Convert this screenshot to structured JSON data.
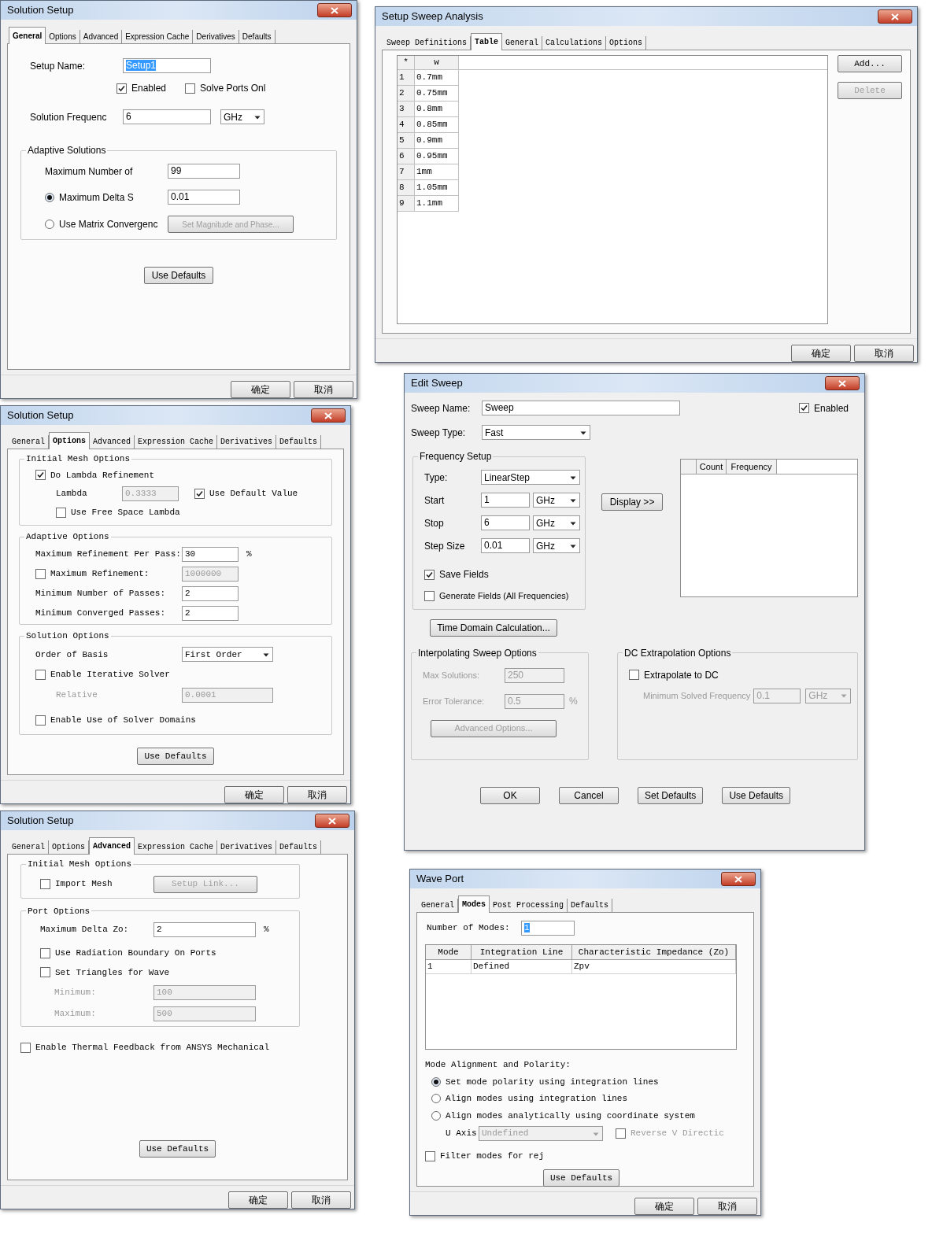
{
  "solution_setup_general": {
    "title": "Solution Setup",
    "tabs": [
      {
        "label": "General",
        "selected": true
      },
      {
        "label": "Options",
        "selected": false
      },
      {
        "label": "Advanced",
        "selected": false
      },
      {
        "label": "Expression Cache",
        "selected": false
      },
      {
        "label": "Derivatives",
        "selected": false
      },
      {
        "label": "Defaults",
        "selected": false
      }
    ],
    "setup_name": {
      "label": "Setup Name:",
      "value": "Setup1",
      "text_selected": true
    },
    "enabled": {
      "label": "Enabled",
      "checked": true
    },
    "solve_ports_only": {
      "label": "Solve Ports Onl",
      "checked": false
    },
    "solution_frequency": {
      "label": "Solution Frequenc",
      "value": "6",
      "unit": "GHz"
    },
    "adaptive_solutions": {
      "title": "Adaptive Solutions",
      "max_passes": {
        "label": "Maximum Number of",
        "value": "99"
      },
      "criteria": [
        {
          "label": "Maximum Delta S",
          "selected": true,
          "value": "0.01"
        },
        {
          "label": "Use Matrix Convergenc",
          "selected": false,
          "button": {
            "label": "Set Magnitude and Phase...",
            "disabled": true
          }
        }
      ]
    },
    "use_defaults": "Use Defaults",
    "buttons": [
      "确定",
      "取消"
    ]
  },
  "setup_sweep_analysis": {
    "title": "Setup Sweep Analysis",
    "tabs": [
      {
        "label": "Sweep Definitions",
        "selected": false
      },
      {
        "label": "Table",
        "selected": true
      },
      {
        "label": "General",
        "selected": false
      },
      {
        "label": "Calculations",
        "selected": false
      },
      {
        "label": "Options",
        "selected": false
      }
    ],
    "table": {
      "columns": [
        "*",
        "w"
      ],
      "rows": [
        [
          "1",
          "0.7mm"
        ],
        [
          "2",
          "0.75mm"
        ],
        [
          "3",
          "0.8mm"
        ],
        [
          "4",
          "0.85mm"
        ],
        [
          "5",
          "0.9mm"
        ],
        [
          "6",
          "0.95mm"
        ],
        [
          "7",
          "1mm"
        ],
        [
          "8",
          "1.05mm"
        ],
        [
          "9",
          "1.1mm"
        ]
      ]
    },
    "side_buttons": [
      {
        "label": "Add...",
        "disabled": false
      },
      {
        "label": "Delete",
        "disabled": true
      }
    ],
    "buttons": [
      "确定",
      "取消"
    ]
  },
  "solution_setup_options": {
    "title": "Solution Setup",
    "tabs": [
      {
        "label": "General",
        "selected": false
      },
      {
        "label": "Options",
        "selected": true
      },
      {
        "label": "Advanced",
        "selected": false
      },
      {
        "label": "Expression Cache",
        "selected": false
      },
      {
        "label": "Derivatives",
        "selected": false
      },
      {
        "label": "Defaults",
        "selected": false
      }
    ],
    "initial_mesh": {
      "title": "Initial Mesh Options",
      "lambda_refinement": {
        "label": "Do Lambda Refinement",
        "checked": true
      },
      "lambda": {
        "label": "Lambda",
        "value": "0.3333",
        "disabled": true
      },
      "use_default": {
        "label": "Use Default Value",
        "checked": true
      },
      "free_space": {
        "label": "Use Free Space Lambda",
        "checked": false
      }
    },
    "adaptive": {
      "title": "Adaptive Options",
      "max_refinement_per_pass": {
        "label": "Maximum Refinement Per Pass:",
        "value": "30",
        "unit": "%"
      },
      "max_refinement": {
        "label": "Maximum Refinement:",
        "checked": false,
        "value": "1000000",
        "disabled": true
      },
      "min_passes": {
        "label": "Minimum Number of Passes:",
        "value": "2"
      },
      "min_converged": {
        "label": "Minimum Converged Passes:",
        "value": "2"
      }
    },
    "solution_options": {
      "title": "Solution Options",
      "order_of_basis": {
        "label": "Order of Basis",
        "value": "First Order"
      },
      "iterative": {
        "label": "Enable Iterative Solver",
        "checked": false
      },
      "relative": {
        "label": "Relative",
        "value": "0.0001",
        "disabled": true
      },
      "solver_domains": {
        "label": "Enable Use of Solver Domains",
        "checked": false
      }
    },
    "use_defaults": "Use Defaults",
    "buttons": [
      "确定",
      "取消"
    ]
  },
  "solution_setup_advanced": {
    "title": "Solution Setup",
    "tabs": [
      {
        "label": "General",
        "selected": false
      },
      {
        "label": "Options",
        "selected": false
      },
      {
        "label": "Advanced",
        "selected": true
      },
      {
        "label": "Expression Cache",
        "selected": false
      },
      {
        "label": "Derivatives",
        "selected": false
      },
      {
        "label": "Defaults",
        "selected": false
      }
    ],
    "initial_mesh": {
      "title": "Initial Mesh Options",
      "import_mesh": {
        "label": "Import Mesh",
        "checked": false
      },
      "setup_link": {
        "label": "Setup Link...",
        "disabled": true
      }
    },
    "port_options": {
      "title": "Port Options",
      "max_delta_zo": {
        "label": "Maximum Delta Zo:",
        "value": "2",
        "unit": "%"
      },
      "radiation_boundary": {
        "label": "Use Radiation Boundary On Ports",
        "checked": false
      },
      "set_triangles": {
        "label": "Set Triangles for Wave",
        "checked": false
      },
      "minimum": {
        "label": "Minimum:",
        "value": "100",
        "disabled": true
      },
      "maximum": {
        "label": "Maximum:",
        "value": "500",
        "disabled": true
      }
    },
    "thermal_feedback": {
      "label": "Enable Thermal Feedback from ANSYS Mechanical",
      "checked": false
    },
    "use_defaults": "Use Defaults",
    "buttons": [
      "确定",
      "取消"
    ]
  },
  "edit_sweep": {
    "title": "Edit Sweep",
    "sweep_name": {
      "label": "Sweep Name:",
      "value": "Sweep"
    },
    "enabled": {
      "label": "Enabled",
      "checked": true
    },
    "sweep_type": {
      "label": "Sweep Type:",
      "value": "Fast"
    },
    "frequency_setup": {
      "title": "Frequency Setup",
      "type": {
        "label": "Type:",
        "value": "LinearStep"
      },
      "rows": [
        {
          "label": "Start",
          "value": "1",
          "unit": "GHz"
        },
        {
          "label": "Stop",
          "value": "6",
          "unit": "GHz"
        },
        {
          "label": "Step Size",
          "value": "0.01",
          "unit": "GHz"
        }
      ],
      "save_fields": {
        "label": "Save Fields",
        "checked": true
      },
      "generate_fields": {
        "label": "Generate Fields (All Frequencies)",
        "checked": false
      }
    },
    "display_button": "Display >>",
    "table": {
      "columns": [
        "Count",
        "Frequency"
      ]
    },
    "time_domain_button": "Time Domain Calculation...",
    "interpolating": {
      "title": "Interpolating Sweep Options",
      "disabled": true,
      "max_solutions": {
        "label": "Max Solutions:",
        "value": "250"
      },
      "error_tolerance": {
        "label": "Error Tolerance:",
        "value": "0.5",
        "unit": "%"
      },
      "advanced_button": "Advanced Options..."
    },
    "dc_extrapolation": {
      "title": "DC Extrapolation Options",
      "extrapolate": {
        "label": "Extrapolate to DC",
        "checked": false
      },
      "min_frequency": {
        "label": "Minimum Solved Frequency",
        "value": "0.1",
        "unit": "GHz",
        "disabled": true
      }
    },
    "buttons": [
      "OK",
      "Cancel",
      "Set Defaults",
      "Use Defaults"
    ]
  },
  "wave_port": {
    "title": "Wave Port",
    "tabs": [
      {
        "label": "General",
        "selected": false
      },
      {
        "label": "Modes",
        "selected": true
      },
      {
        "label": "Post Processing",
        "selected": false
      },
      {
        "label": "Defaults",
        "selected": false
      }
    ],
    "number_of_modes": {
      "label": "Number of Modes:",
      "value": "1",
      "text_selected": true
    },
    "table": {
      "columns": [
        "Mode",
        "Integration Line",
        "Characteristic Impedance (Zo)"
      ],
      "rows": [
        [
          "1",
          "Defined",
          "Zpv"
        ]
      ]
    },
    "alignment": {
      "title": "Mode Alignment and Polarity:",
      "options": [
        {
          "label": "Set mode polarity using integration lines",
          "selected": true
        },
        {
          "label": "Align modes using integration lines",
          "selected": false
        },
        {
          "label": "Align modes analytically using coordinate system",
          "selected": false
        }
      ],
      "u_axis": {
        "label": "U Axis",
        "value": "Undefined",
        "disabled": true
      },
      "reverse_v": {
        "label": "Reverse V Directic",
        "checked": false,
        "disabled": true
      }
    },
    "filter_modes": {
      "label": "Filter modes for rej",
      "checked": false
    },
    "use_defaults": "Use Defaults",
    "buttons": [
      "确定",
      "取消"
    ]
  }
}
